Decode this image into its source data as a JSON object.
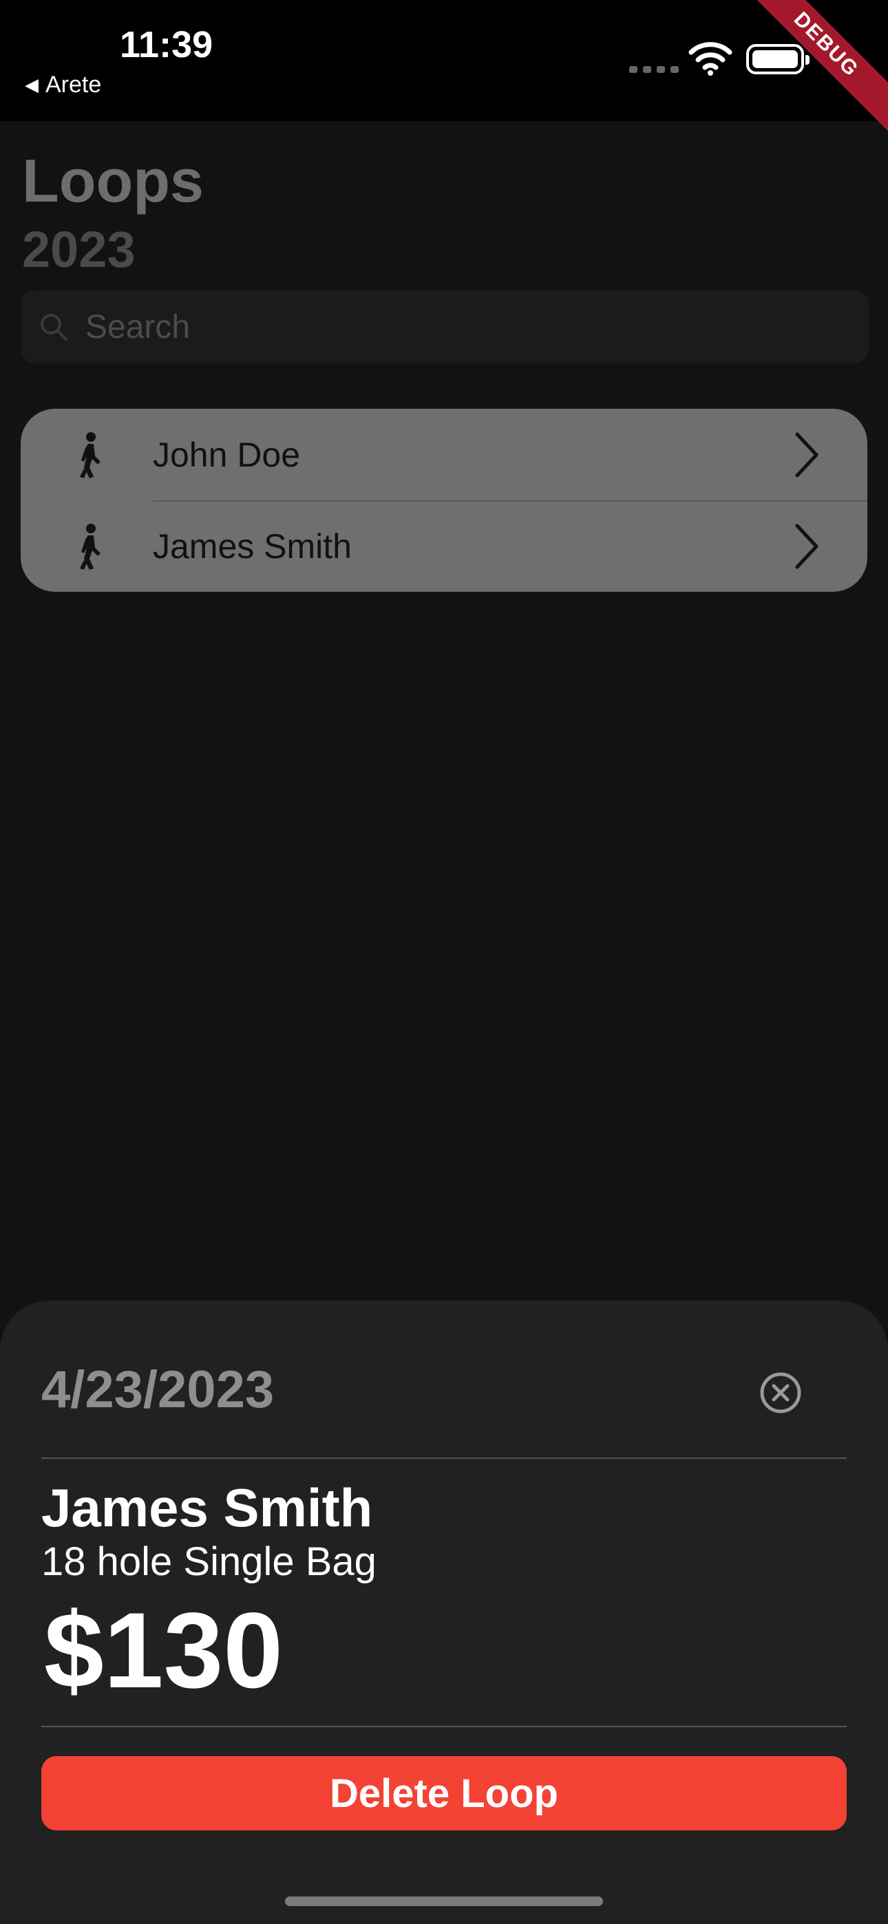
{
  "status_bar": {
    "time": "11:39",
    "back_label": "Arete",
    "debug_label": "DEBUG"
  },
  "header": {
    "title": "Loops",
    "subtitle": "2023"
  },
  "search": {
    "placeholder": "Search"
  },
  "list": {
    "items": [
      {
        "name": "John Doe",
        "icon": "walking-person-icon"
      },
      {
        "name": "James Smith",
        "icon": "walking-person-icon"
      }
    ]
  },
  "sheet": {
    "date": "4/23/2023",
    "name": "James Smith",
    "description": "18 hole Single Bag",
    "amount": "$130",
    "delete_label": "Delete Loop"
  },
  "colors": {
    "background": "#121212",
    "sheet": "#212121",
    "list_card": "#6f6f6f",
    "delete_button": "#f44235"
  }
}
